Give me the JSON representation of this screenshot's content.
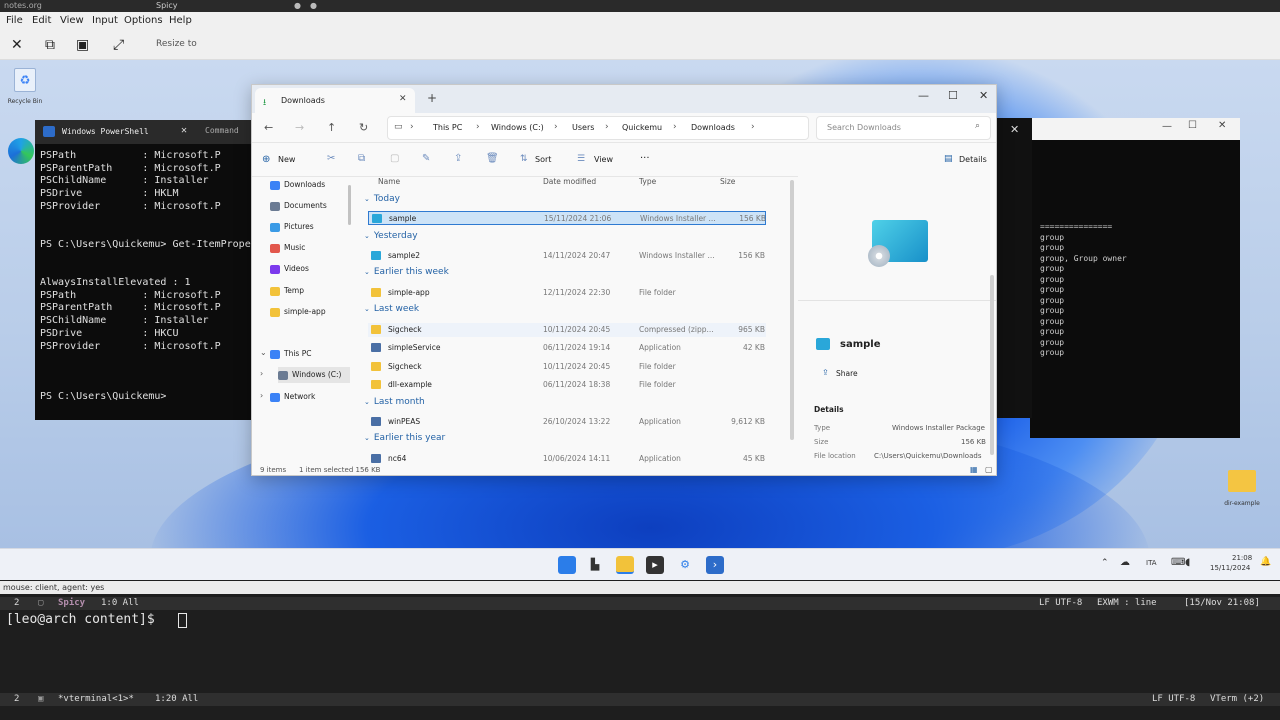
{
  "topbar": {
    "left_text": "notes.org",
    "title": "Spicy"
  },
  "menubar": {
    "items": [
      "File",
      "Edit",
      "View",
      "Input",
      "Options",
      "Help"
    ]
  },
  "toolbar": {
    "resize_label": "Resize to"
  },
  "desktop": {
    "recycle_bin_label": "Recycle Bin",
    "edge_label": "Microsoft Edge",
    "folder_label": "dir-example"
  },
  "powershell": {
    "tab_title": "Windows PowerShell",
    "tab2_title": "Command",
    "lines": [
      "PSPath           : Microsoft.P",
      "PSParentPath     : Microsoft.P",
      "PSChildName      : Installer",
      "PSDrive          : HKLM",
      "PSProvider       : Microsoft.P",
      "",
      "",
      "PS C:\\Users\\Quickemu> Get-ItemProper",
      "",
      "",
      "AlwaysInstallElevated : 1",
      "PSPath           : Microsoft.P",
      "PSParentPath     : Microsoft.P",
      "PSChildName      : Installer",
      "PSDrive          : HKCU",
      "PSProvider       : Microsoft.P",
      "",
      "",
      "",
      "PS C:\\Users\\Quickemu>"
    ]
  },
  "cmdwin": {
    "lines": [
      "===============",
      "group",
      "group",
      "group, Group owner",
      "group",
      "group",
      "group",
      "group",
      "group",
      "group",
      "group",
      "group",
      "group"
    ]
  },
  "explorer": {
    "tab_title": "Downloads",
    "breadcrumb": [
      "This PC",
      "Windows (C:)",
      "Users",
      "Quickemu",
      "Downloads"
    ],
    "search_placeholder": "Search Downloads",
    "commands": {
      "new": "New",
      "sort": "Sort",
      "view": "View",
      "more": "···",
      "details": "Details"
    },
    "sidebar": [
      {
        "label": "Downloads",
        "color": "#3b82f6"
      },
      {
        "label": "Documents",
        "color": "#6b7b93"
      },
      {
        "label": "Pictures",
        "color": "#3b9be6"
      },
      {
        "label": "Music",
        "color": "#e2574c"
      },
      {
        "label": "Videos",
        "color": "#7c3aed"
      },
      {
        "label": "Temp",
        "color": "#f2c23a"
      },
      {
        "label": "simple-app",
        "color": "#f2c23a"
      },
      {
        "label": "This PC",
        "color": "#3b82f6"
      },
      {
        "label": "Windows (C:)",
        "color": "#6b7b93"
      },
      {
        "label": "Network",
        "color": "#3b82f6"
      }
    ],
    "columns": {
      "name": "Name",
      "date": "Date modified",
      "type": "Type",
      "size": "Size"
    },
    "groups": [
      "Today",
      "Yesterday",
      "Earlier this week",
      "Last week",
      "Last month",
      "Earlier this year"
    ],
    "rows": [
      {
        "name": "sample",
        "date": "15/11/2024 21:06",
        "type": "Windows Installer ...",
        "size": "156 KB"
      },
      {
        "name": "sample2",
        "date": "14/11/2024 20:47",
        "type": "Windows Installer ...",
        "size": "156 KB"
      },
      {
        "name": "simple-app",
        "date": "12/11/2024 22:30",
        "type": "File folder",
        "size": ""
      },
      {
        "name": "Sigcheck",
        "date": "10/11/2024 20:45",
        "type": "Compressed (zipp...",
        "size": "965 KB"
      },
      {
        "name": "simpleService",
        "date": "06/11/2024 19:14",
        "type": "Application",
        "size": "42 KB"
      },
      {
        "name": "Sigcheck",
        "date": "10/11/2024 20:45",
        "type": "File folder",
        "size": ""
      },
      {
        "name": "dll-example",
        "date": "06/11/2024 18:38",
        "type": "File folder",
        "size": ""
      },
      {
        "name": "winPEAS",
        "date": "26/10/2024 13:22",
        "type": "Application",
        "size": "9,612 KB"
      },
      {
        "name": "nc64",
        "date": "10/06/2024 14:11",
        "type": "Application",
        "size": "45 KB"
      }
    ],
    "details": {
      "file_name": "sample",
      "share": "Share",
      "heading": "Details",
      "type_label": "Type",
      "type_value": "Windows Installer Package",
      "size_label": "Size",
      "size_value": "156 KB",
      "location_label": "File location",
      "location_value": "C:\\Users\\Quickemu\\Downloads"
    },
    "status": {
      "items": "9 items",
      "selected": "1 item selected  156 KB"
    }
  },
  "taskbar": {
    "time": "21:08",
    "date": "15/11/2024",
    "lang": "ITA"
  },
  "statusline": {
    "text": "mouse: client, agent: yes"
  },
  "modeline1": {
    "num": "2",
    "buffer": "Spicy",
    "pos": "1:0 All",
    "enc": "LF UTF-8",
    "mode": "EXWM : line",
    "date": "[15/Nov 21:08]"
  },
  "terminal": {
    "prompt": "[leo@arch content]$ "
  },
  "modeline2": {
    "num": "2",
    "buffer": "*vterminal<1>*",
    "pos": "1:20 All",
    "enc": "LF UTF-8",
    "mode": "VTerm (+2)"
  }
}
